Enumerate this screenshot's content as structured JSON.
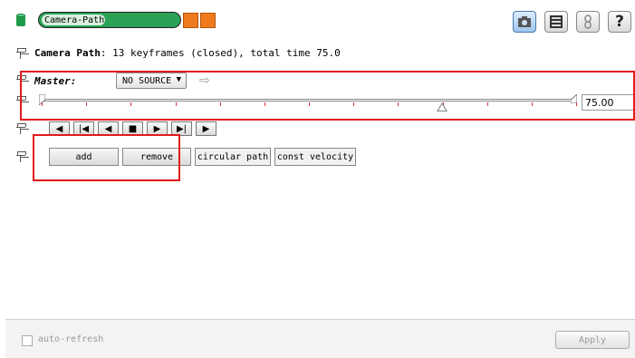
{
  "header": {
    "title": "Camera-Path",
    "right_buttons": [
      {
        "name": "camera-view-icon",
        "label": ""
      },
      {
        "name": "list-view-icon",
        "label": ""
      },
      {
        "name": "link-icon",
        "label": ""
      },
      {
        "name": "help-icon",
        "label": "?"
      }
    ]
  },
  "info": {
    "label": "Camera Path",
    "text": ": 13 keyframes (closed), total time 75.0"
  },
  "master": {
    "label": "Master:",
    "source_value": "NO SOURCE",
    "dropdown_arrow": "▼",
    "arrow": "⇨"
  },
  "timeline": {
    "keyframe_count": 13,
    "current_time": 75.0,
    "total_time": 75.0,
    "value": "75.00"
  },
  "transport": {
    "buttons": [
      {
        "name": "first-frame-button",
        "glyph": "◀"
      },
      {
        "name": "prev-key-button",
        "glyph": "|◀"
      },
      {
        "name": "step-back-button",
        "glyph": "◀"
      },
      {
        "name": "stop-button",
        "glyph": "■"
      },
      {
        "name": "step-forward-button",
        "glyph": "▶"
      },
      {
        "name": "next-key-button",
        "glyph": "▶|"
      },
      {
        "name": "play-button",
        "glyph": "▶"
      }
    ]
  },
  "actions": {
    "add": "add",
    "remove": "remove",
    "circular": "circular path",
    "velocity": "const velocity"
  },
  "footer": {
    "auto_refresh": "auto-refresh",
    "apply": "Apply"
  },
  "colors": {
    "accent": "#2aa255",
    "orange": "#ef7a1d",
    "highlight": "#e01b1b"
  }
}
